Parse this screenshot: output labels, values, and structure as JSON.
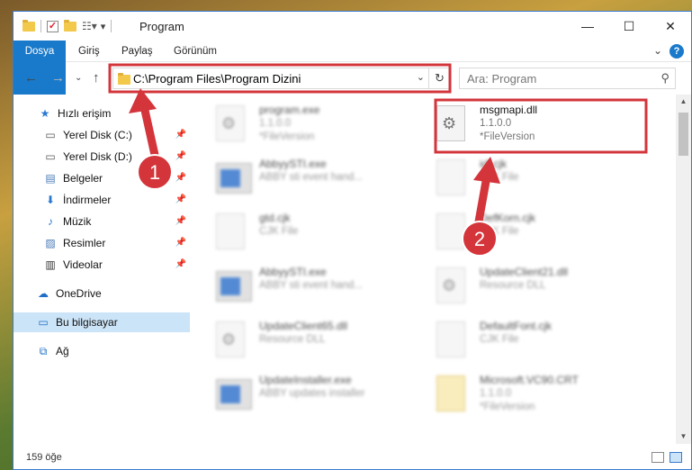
{
  "window": {
    "title": "Program",
    "controls": [
      "—",
      "☐",
      "✕"
    ]
  },
  "ribbon": {
    "tabs": [
      "Dosya",
      "Giriş",
      "Paylaş",
      "Görünüm"
    ]
  },
  "address": {
    "path": "C:\\Program Files\\Program Dizini",
    "search_placeholder": "Ara: Program"
  },
  "sidebar": {
    "items": [
      {
        "label": "Hızlı erişim",
        "icon": "star-icon",
        "pinned": false
      },
      {
        "label": "Yerel Disk (C:)",
        "icon": "drive-icon",
        "pinned": true
      },
      {
        "label": "Yerel Disk (D:)",
        "icon": "drive-icon",
        "pinned": true
      },
      {
        "label": "Belgeler",
        "icon": "documents-icon",
        "pinned": true
      },
      {
        "label": "İndirmeler",
        "icon": "download-icon",
        "pinned": true
      },
      {
        "label": "Müzik",
        "icon": "music-icon",
        "pinned": true
      },
      {
        "label": "Resimler",
        "icon": "pictures-icon",
        "pinned": true
      },
      {
        "label": "Videolar",
        "icon": "video-icon",
        "pinned": true
      },
      {
        "label": "OneDrive",
        "icon": "cloud-icon",
        "pinned": false
      },
      {
        "label": "Bu bilgisayar",
        "icon": "computer-icon",
        "pinned": false,
        "selected": true
      },
      {
        "label": "Ağ",
        "icon": "network-icon",
        "pinned": false
      }
    ]
  },
  "files": [
    {
      "name": "program.exe",
      "line2": "1.1.0.0",
      "line3": "*FileVersion",
      "kind": "app-gear",
      "blurred": true
    },
    {
      "name": "msgmapi.dll",
      "line2": "1.1.0.0",
      "line3": "*FileVersion",
      "kind": "gear",
      "blurred": false,
      "highlighted": true
    },
    {
      "name": "AbbyySTI.exe",
      "line2": "ABBY sti event hand...",
      "line3": "",
      "kind": "app",
      "blurred": true
    },
    {
      "name": "idl.cjk",
      "line2": "CJK File",
      "line3": "",
      "kind": "doc",
      "blurred": true
    },
    {
      "name": "gtd.cjk",
      "line2": "CJK File",
      "line3": "",
      "kind": "doc",
      "blurred": true
    },
    {
      "name": "DefKorn.cjk",
      "line2": "CJK File",
      "line3": "",
      "kind": "doc",
      "blurred": true
    },
    {
      "name": "AbbyySTI.exe",
      "line2": "ABBY sti event hand...",
      "line3": "",
      "kind": "app",
      "blurred": true
    },
    {
      "name": "UpdateClient21.dll",
      "line2": "Resource DLL",
      "line3": "",
      "kind": "gear",
      "blurred": true
    },
    {
      "name": "UpdateClient65.dll",
      "line2": "Resource DLL",
      "line3": "",
      "kind": "gear",
      "blurred": true
    },
    {
      "name": "DefaultFont.cjk",
      "line2": "CJK File",
      "line3": "",
      "kind": "doc",
      "blurred": true
    },
    {
      "name": "UpdateInstaller.exe",
      "line2": "ABBY updates installer",
      "line3": "",
      "kind": "app",
      "blurred": true
    },
    {
      "name": "Microsoft.VC90.CRT",
      "line2": "1.1.0.0",
      "line3": "*FileVersion",
      "kind": "doc",
      "blurred": true
    }
  ],
  "annotations": {
    "badge1": "1",
    "badge2": "2",
    "arrow_color": "#d3353b"
  },
  "status": {
    "count": "159 öğe"
  }
}
